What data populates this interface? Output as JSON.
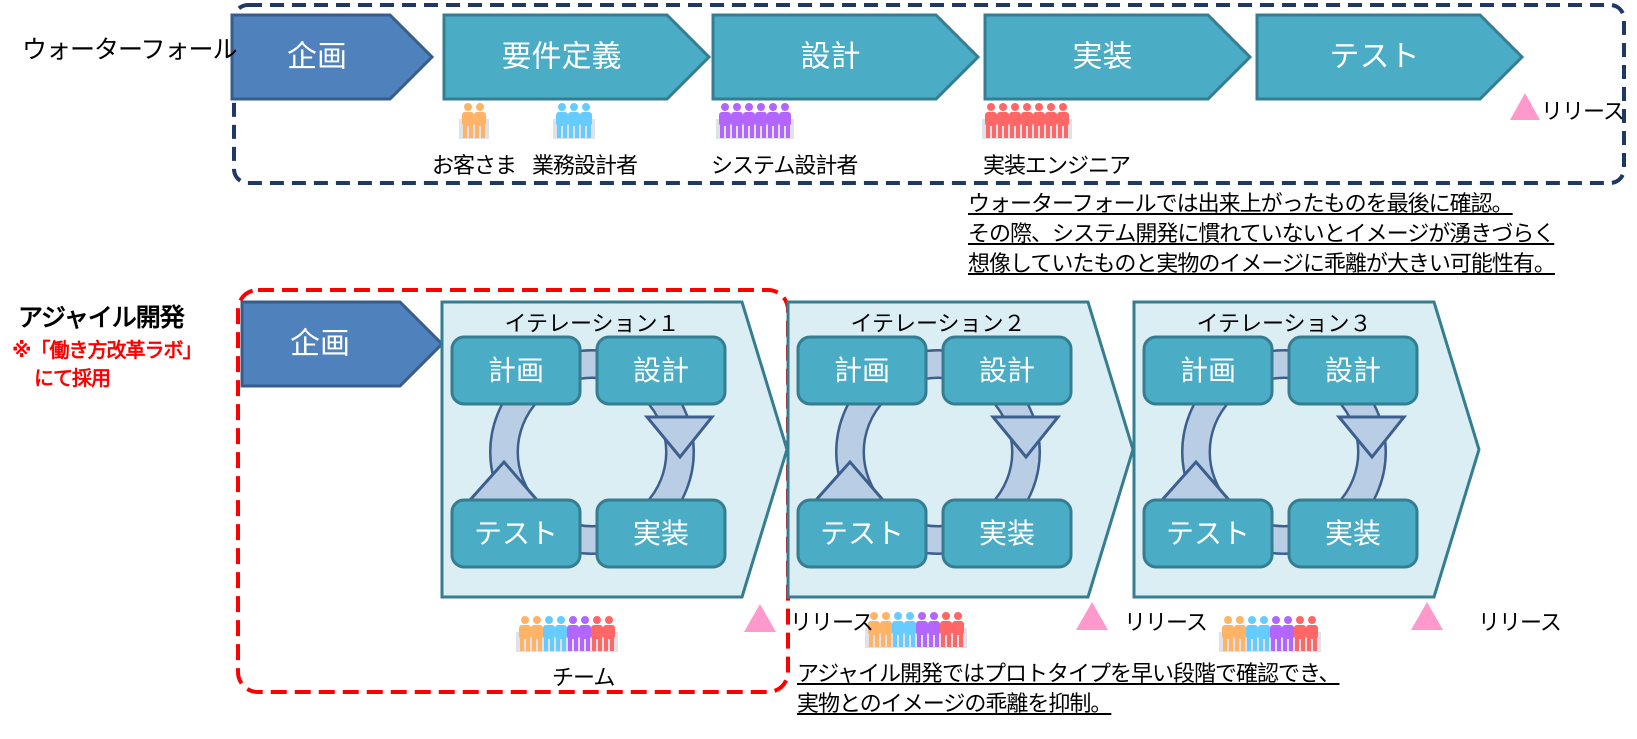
{
  "waterfall": {
    "title": "ウォーターフォール",
    "phases": [
      {
        "label": "企画",
        "kind": "plan"
      },
      {
        "label": "要件定義",
        "kind": "phase"
      },
      {
        "label": "設計",
        "kind": "phase"
      },
      {
        "label": "実装",
        "kind": "phase"
      },
      {
        "label": "テスト",
        "kind": "phase"
      }
    ],
    "roles": [
      {
        "label": "お客さま",
        "people": 2,
        "color": "#ffb366"
      },
      {
        "label": "業務設計者",
        "people": 3,
        "color": "#66ccff"
      },
      {
        "label": "システム設計者",
        "people": 6,
        "color": "#b366ff"
      },
      {
        "label": "実装エンジニア",
        "people": 7,
        "color": "#ff6666"
      }
    ],
    "release_label": "リリース",
    "callout_lines": [
      "ウォーターフォールでは出来上がったものを最後に確認。",
      "その際、システム開発に慣れていないとイメージが湧きづらく",
      "想像していたものと実物のイメージに乖離が大きい可能性有。"
    ]
  },
  "agile": {
    "title": "アジャイル開発",
    "note_line1": "※「働き方改革ラボ」",
    "note_line2": "にて採用",
    "plan_label": "企画",
    "iterations": [
      {
        "title": "イテレーション１",
        "steps": [
          "計画",
          "設計",
          "テスト",
          "実装"
        ],
        "release_label": "リリース"
      },
      {
        "title": "イテレーション２",
        "steps": [
          "計画",
          "設計",
          "テスト",
          "実装"
        ],
        "release_label": "リリース"
      },
      {
        "title": "イテレーション３",
        "steps": [
          "計画",
          "設計",
          "テスト",
          "実装"
        ],
        "release_label": "リリース"
      }
    ],
    "team_label": "チーム",
    "team_colors": [
      "#ffb366",
      "#ffb366",
      "#66ccff",
      "#66ccff",
      "#b366ff",
      "#b366ff",
      "#ff6666",
      "#ff6666"
    ],
    "callout_lines": [
      "アジャイル開発ではプロトタイプを早い段階で確認でき、",
      "実物とのイメージの乖離を抑制。"
    ]
  },
  "colors": {
    "plan_fill": "#4f81bd",
    "plan_stroke": "#385d8a",
    "phase_fill": "#4bacc6",
    "phase_stroke": "#357d91",
    "iteration_fill": "#dbeef4",
    "cycle_arrow_fill": "#b9cde5",
    "cycle_arrow_stroke": "#3d5f8e",
    "waterfall_frame": "#1f3864",
    "agile_frame": "#ff0000",
    "release_marker": "#ff99cc"
  }
}
